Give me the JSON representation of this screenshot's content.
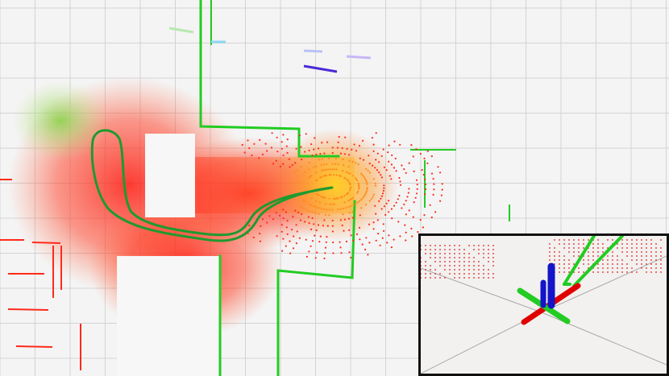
{
  "viewer": {
    "background_color": "#f4f4f4",
    "grid_color": "#d3d3d3",
    "grid_visible": true
  },
  "map": {
    "wall_color": "#22cc22",
    "scan_near_color": "#ff2a1a",
    "scan_mid_color": "#ff8a1a",
    "scan_far_color": "#ffd21a",
    "trajectory_color": "#1f9a2f"
  },
  "inset": {
    "label": "",
    "border_color": "#111111",
    "background_color": "#f2f1ef",
    "axes": {
      "x_color": "#e00000",
      "y_color": "#22cc22",
      "z_color": "#1414c8"
    }
  }
}
